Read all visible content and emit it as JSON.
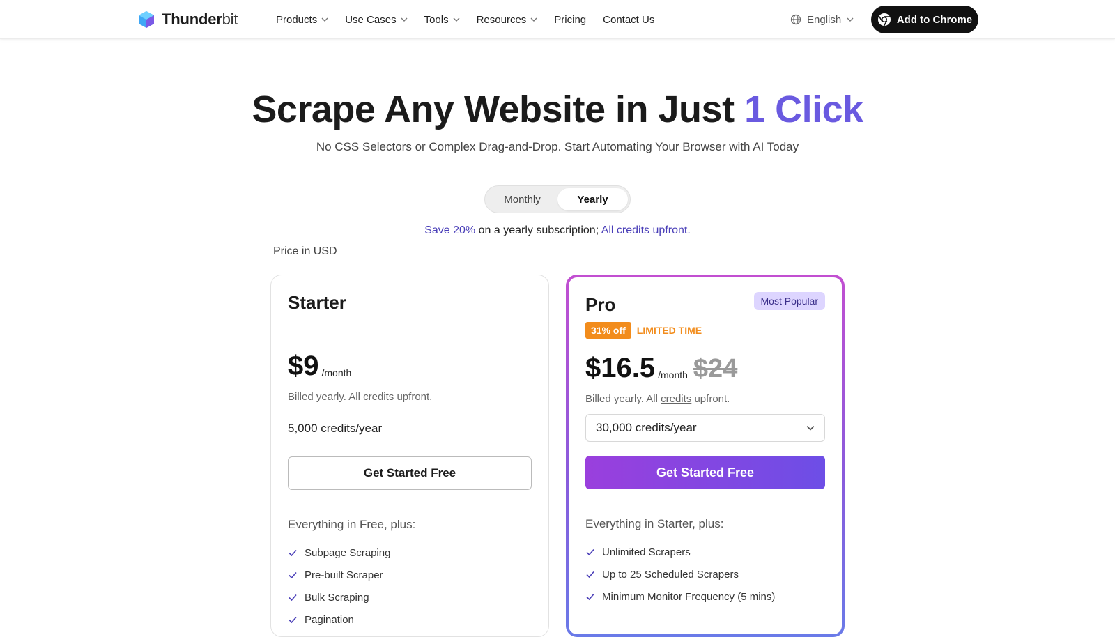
{
  "header": {
    "logo_bold": "Thunder",
    "logo_light": "bit",
    "nav": [
      {
        "label": "Products",
        "has_dropdown": true
      },
      {
        "label": "Use Cases",
        "has_dropdown": true
      },
      {
        "label": "Tools",
        "has_dropdown": true
      },
      {
        "label": "Resources",
        "has_dropdown": true
      },
      {
        "label": "Pricing",
        "has_dropdown": false
      },
      {
        "label": "Contact Us",
        "has_dropdown": false
      }
    ],
    "language": "English",
    "cta": "Add to Chrome"
  },
  "hero": {
    "title_main": "Scrape Any Website in Just",
    "title_accent": "1 Click",
    "subtitle": "No CSS Selectors or Complex Drag-and-Drop. Start Automating Your Browser with AI Today"
  },
  "billing_toggle": {
    "options": [
      "Monthly",
      "Yearly"
    ],
    "selected": "Yearly"
  },
  "save_line": {
    "highlight": "Save 20%",
    "middle": "on a yearly subscription;",
    "link": "All credits upfront."
  },
  "price_currency_note": "Price in USD",
  "plans": {
    "starter": {
      "name": "Starter",
      "price": "$9",
      "per": "/month",
      "billed_prefix": "Billed yearly. All",
      "billed_link": "credits",
      "billed_suffix": "upfront.",
      "credits": "5,000 credits/year",
      "button": "Get Started Free",
      "features_heading": "Everything in Free, plus:",
      "features": [
        "Subpage Scraping",
        "Pre-built Scraper",
        "Bulk Scraping",
        "Pagination"
      ]
    },
    "pro": {
      "name": "Pro",
      "badge": "Most Popular",
      "discount": "31% off",
      "limited": "LIMITED TIME",
      "price": "$16.5",
      "per": "/month",
      "old_price": "$24",
      "billed_prefix": "Billed yearly. All",
      "billed_link": "credits",
      "billed_suffix": "upfront.",
      "credits_selected": "30,000 credits/year",
      "button": "Get Started Free",
      "features_heading": "Everything in Starter, plus:",
      "features": [
        "Unlimited Scrapers",
        "Up to 25 Scheduled Scrapers",
        "Minimum Monitor Frequency (5 mins)"
      ]
    }
  },
  "colors": {
    "accent": "#6a5ae0",
    "discount_orange": "#f28c1c",
    "pro_button_start": "#9a3fdd",
    "pro_button_end": "#6d4ee6"
  },
  "icons": [
    "thunderbit-logo-icon",
    "chevron-down-icon",
    "globe-icon",
    "chrome-icon",
    "check-icon"
  ]
}
